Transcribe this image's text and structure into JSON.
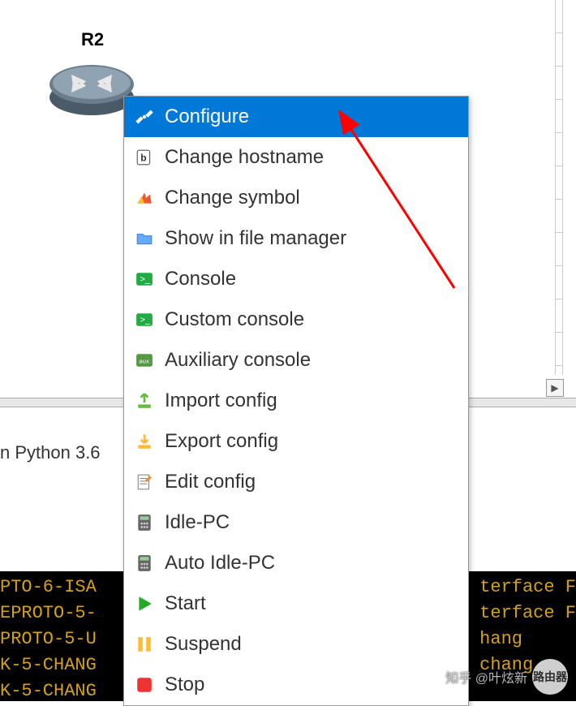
{
  "canvas": {
    "router_label": "R2"
  },
  "context_menu": {
    "items": [
      {
        "icon": "tools-icon",
        "label": "Configure",
        "selected": true
      },
      {
        "icon": "rename-icon",
        "label": "Change hostname",
        "selected": false
      },
      {
        "icon": "symbol-icon",
        "label": "Change symbol",
        "selected": false
      },
      {
        "icon": "folder-icon",
        "label": "Show in file manager",
        "selected": false
      },
      {
        "icon": "console-icon",
        "label": "Console",
        "selected": false
      },
      {
        "icon": "console-icon",
        "label": "Custom console",
        "selected": false
      },
      {
        "icon": "aux-console-icon",
        "label": "Auxiliary console",
        "selected": false
      },
      {
        "icon": "import-icon",
        "label": "Import config",
        "selected": false
      },
      {
        "icon": "export-icon",
        "label": "Export config",
        "selected": false
      },
      {
        "icon": "edit-icon",
        "label": "Edit config",
        "selected": false
      },
      {
        "icon": "calc-icon",
        "label": "Idle-PC",
        "selected": false
      },
      {
        "icon": "calc-icon",
        "label": "Auto Idle-PC",
        "selected": false
      },
      {
        "icon": "play-icon",
        "label": "Start",
        "selected": false
      },
      {
        "icon": "pause-icon",
        "label": "Suspend",
        "selected": false
      },
      {
        "icon": "stop-icon",
        "label": "Stop",
        "selected": false
      }
    ]
  },
  "status": {
    "python_text": "n Python 3.6"
  },
  "terminal": {
    "lines": [
      "PTO-6-ISA",
      "EPROTO-5-",
      "PROTO-5-U",
      "K-5-CHANG",
      "K-5-CHANG"
    ],
    "right_lines": [
      "",
      "terface F",
      "terface F",
      "hang",
      "chang"
    ]
  },
  "watermark": {
    "badge": "路由器",
    "text": "知乎 @叶炫新"
  }
}
